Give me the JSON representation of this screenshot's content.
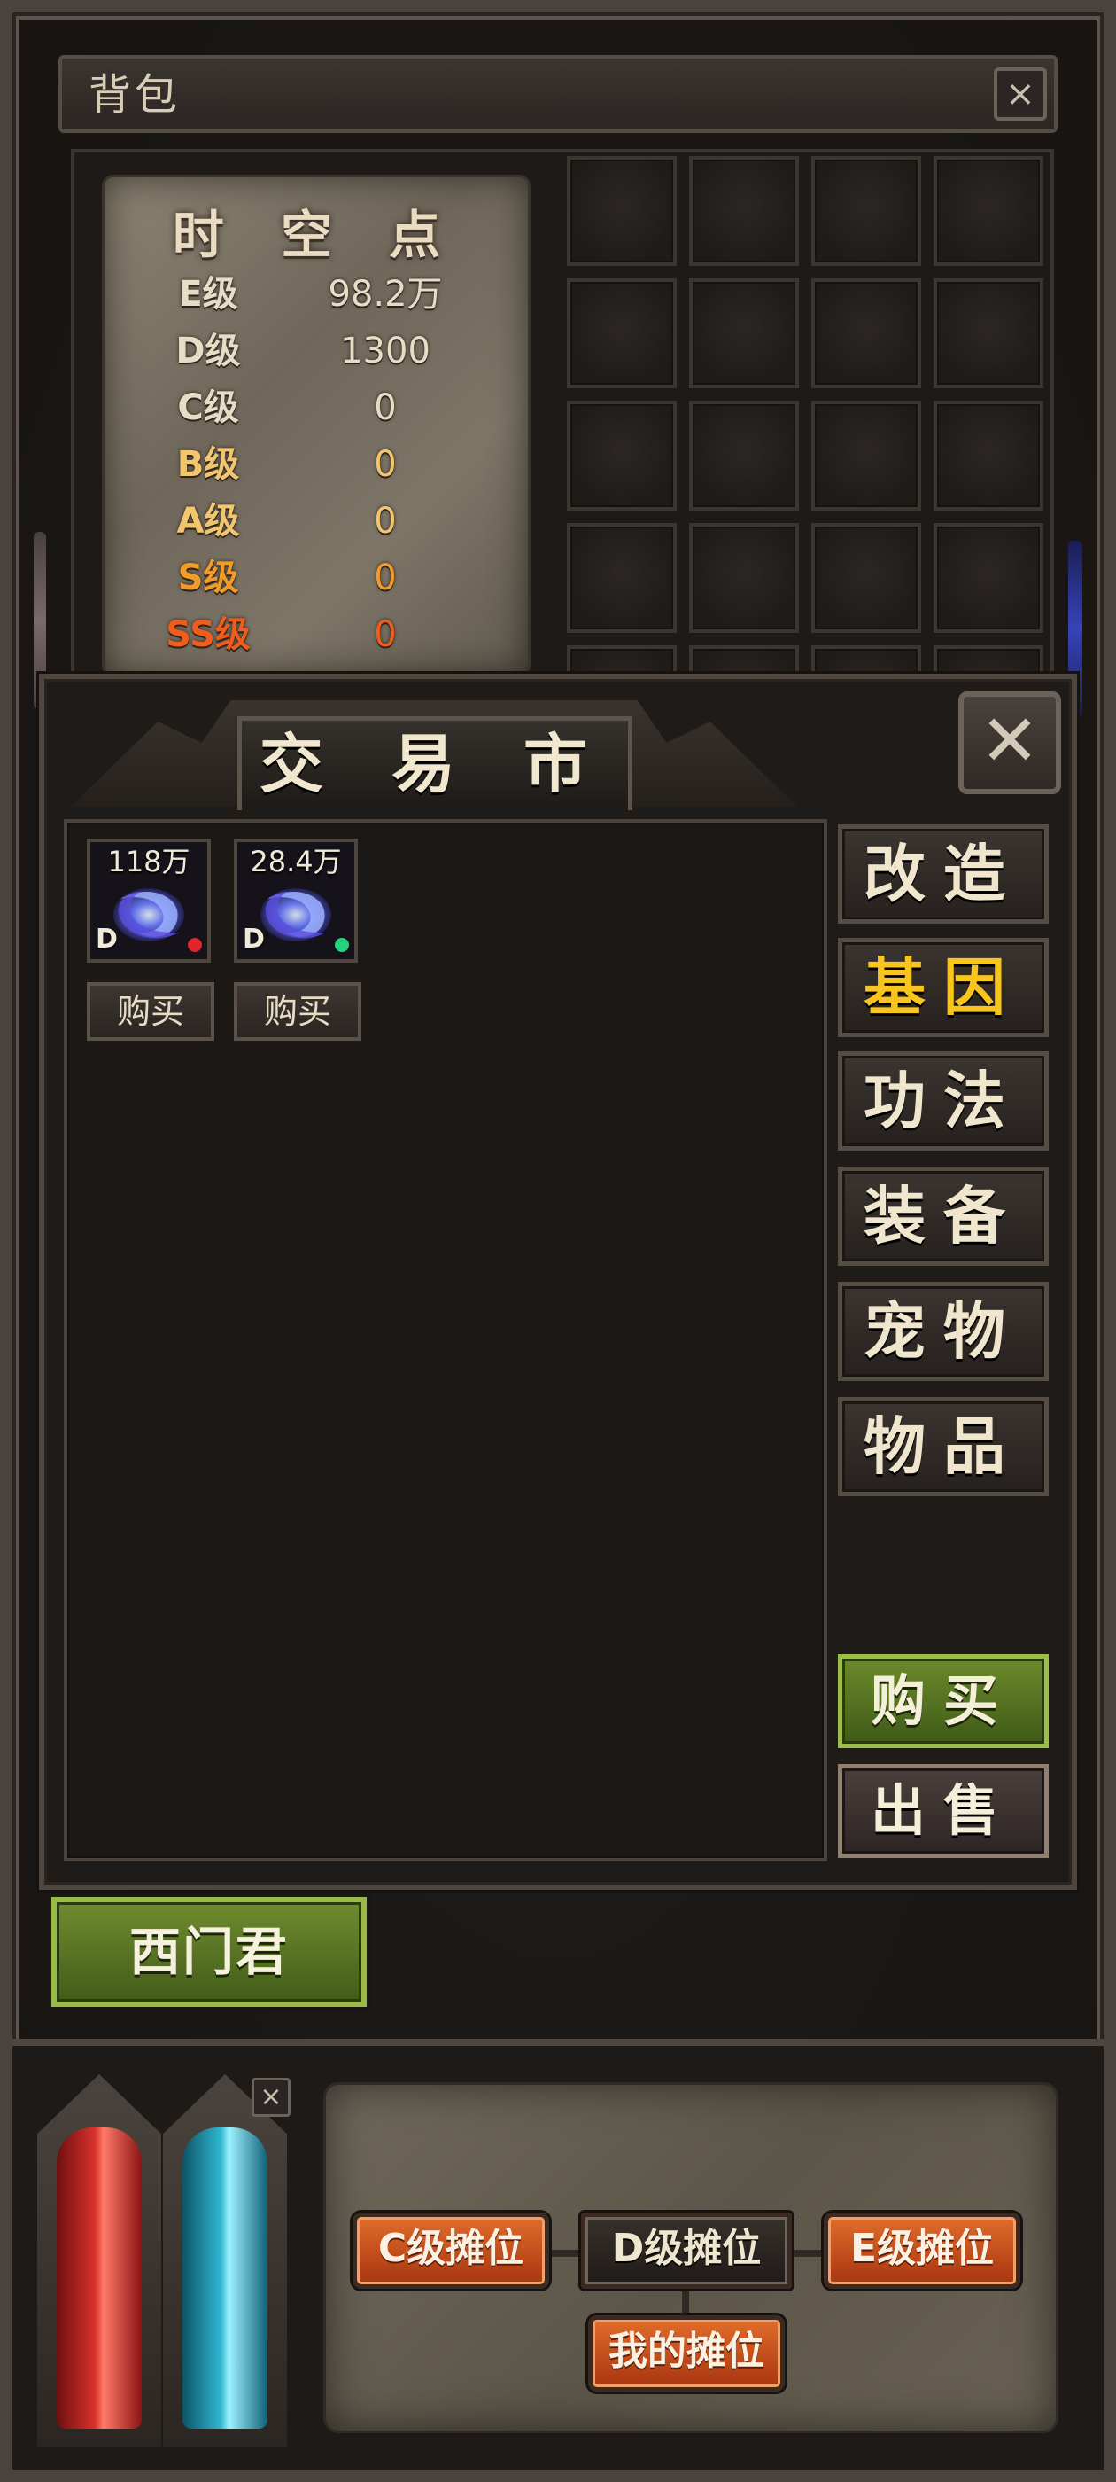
{
  "backpack": {
    "title": "背包",
    "close_glyph": "×",
    "time_points": {
      "title": "时 空 点",
      "grades": [
        {
          "grade": "E级",
          "value": "98.2万",
          "color": "#e7dcc5"
        },
        {
          "grade": "D级",
          "value": "1300",
          "color": "#e7dcc5"
        },
        {
          "grade": "C级",
          "value": "0",
          "color": "#e7dcc5"
        },
        {
          "grade": "B级",
          "value": "0",
          "color": "#f2c66e"
        },
        {
          "grade": "A级",
          "value": "0",
          "color": "#f2c66e"
        },
        {
          "grade": "S级",
          "value": "0",
          "color": "#f19b2b"
        },
        {
          "grade": "SS级",
          "value": "0",
          "color": "#ee5d1c"
        }
      ]
    }
  },
  "market": {
    "title": "交 易 市 场",
    "close_glyph": "✕",
    "listings": [
      {
        "price": "118万",
        "grade": "D",
        "icon": "blue-gene-swirl-icon",
        "marker_color": "#e0242b",
        "buy_label": "购买"
      },
      {
        "price": "28.4万",
        "grade": "D",
        "icon": "blue-gene-swirl-icon",
        "marker_color": "#24d37c",
        "buy_label": "购买"
      }
    ],
    "categories": [
      {
        "label": "改造",
        "active": false
      },
      {
        "label": "基因",
        "active": true
      },
      {
        "label": "功法",
        "active": false
      },
      {
        "label": "装备",
        "active": false
      },
      {
        "label": "宠物",
        "active": false
      },
      {
        "label": "物品",
        "active": false
      }
    ],
    "buy_label": "购买",
    "sell_label": "出售",
    "player_name": "西门君"
  },
  "bottom": {
    "close_glyph": "×",
    "hp_color": "#d8322c",
    "mp_color": "#2fb6cf",
    "stalls": {
      "c": "C级摊位",
      "d": "D级摊位",
      "e": "E级摊位",
      "mine": "我的摊位"
    }
  }
}
